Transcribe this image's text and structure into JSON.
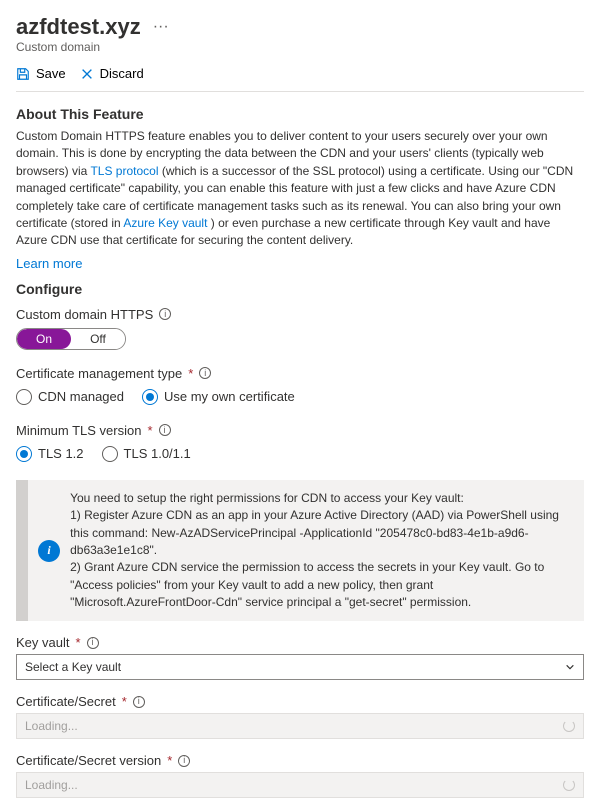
{
  "header": {
    "title": "azfdtest.xyz",
    "subtitle": "Custom domain"
  },
  "toolbar": {
    "save_label": "Save",
    "discard_label": "Discard"
  },
  "about": {
    "heading": "About This Feature",
    "body_pre": "Custom Domain HTTPS feature enables you to deliver content to your users securely over your own domain. This is done by encrypting the data between the CDN and your users' clients (typically web browsers) via ",
    "tls_link": "TLS protocol",
    "body_mid": " (which is a successor of the SSL protocol) using a certificate. Using our \"CDN managed certificate\" capability, you can enable this feature with just a few clicks and have Azure CDN completely take care of certificate management tasks such as its renewal. You can also bring your own certificate (stored in ",
    "kv_link": "Azure Key vault",
    "body_post": " ) or even purchase a new certificate through Key vault and have Azure CDN use that certificate for securing the content delivery.",
    "learn_more": "Learn more"
  },
  "configure": {
    "heading": "Configure",
    "https_label": "Custom domain HTTPS",
    "toggle_on": "On",
    "toggle_off": "Off",
    "cert_type_label": "Certificate management type",
    "cert_type_options": {
      "cdn": "CDN managed",
      "own": "Use my own certificate"
    },
    "tls_label": "Minimum TLS version",
    "tls_options": {
      "v12": "TLS 1.2",
      "v10": "TLS 1.0/1.1"
    }
  },
  "callout": {
    "line0": "You need to setup the right permissions for CDN to access your Key vault:",
    "line1": "1) Register Azure CDN as an app in your Azure Active Directory (AAD) via PowerShell using this command: New-AzADServicePrincipal -ApplicationId \"205478c0-bd83-4e1b-a9d6-db63a3e1e1c8\".",
    "line2": "2) Grant Azure CDN service the permission to access the secrets in your Key vault. Go to \"Access policies\" from your Key vault to add a new policy, then grant \"Microsoft.AzureFrontDoor-Cdn\" service principal a \"get-secret\" permission."
  },
  "fields": {
    "key_vault_label": "Key vault",
    "key_vault_placeholder": "Select a Key vault",
    "cert_secret_label": "Certificate/Secret",
    "cert_secret_placeholder": "Loading...",
    "cert_version_label": "Certificate/Secret version",
    "cert_version_placeholder": "Loading..."
  }
}
